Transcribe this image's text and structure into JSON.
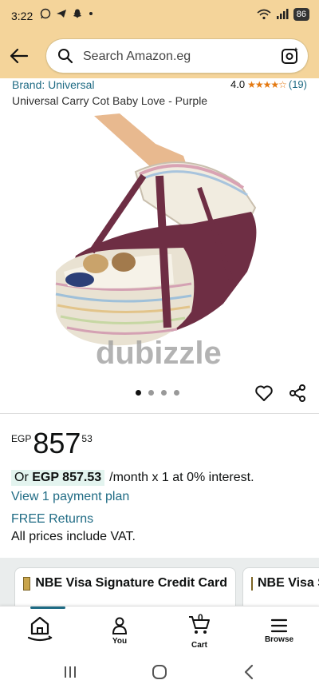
{
  "status_bar": {
    "time": "3:22",
    "battery": "86"
  },
  "search": {
    "placeholder": "Search Amazon.eg"
  },
  "product": {
    "brand": "Brand: Universal",
    "rating_value": "4.0",
    "rating_stars": "★★★★☆",
    "rating_count": "(19)",
    "title": "Universal Carry Cot Baby Love - Purple",
    "watermark": "dubizzle",
    "image_count": 4,
    "active_image": 1
  },
  "price": {
    "currency": "EGP",
    "whole": "857",
    "fraction": "53"
  },
  "installment": {
    "prefix": "Or",
    "amount": "EGP 857.53",
    "suffix": "/month x 1 at 0% interest."
  },
  "links": {
    "payment_plan": "View 1 payment plan",
    "free_returns": "FREE Returns"
  },
  "vat_note": "All prices include VAT.",
  "offers": [
    {
      "label": "NBE Visa Signature Credit Card"
    },
    {
      "label": "NBE Visa Signature Credit Card"
    }
  ],
  "bottom_nav": {
    "home": "",
    "you": "You",
    "cart": "Cart",
    "cart_count": "0",
    "browse": "Browse"
  },
  "colors": {
    "header": "#f4d49a",
    "link": "#1f6b84",
    "star": "#e47911",
    "badge": "#e3f4ef"
  }
}
